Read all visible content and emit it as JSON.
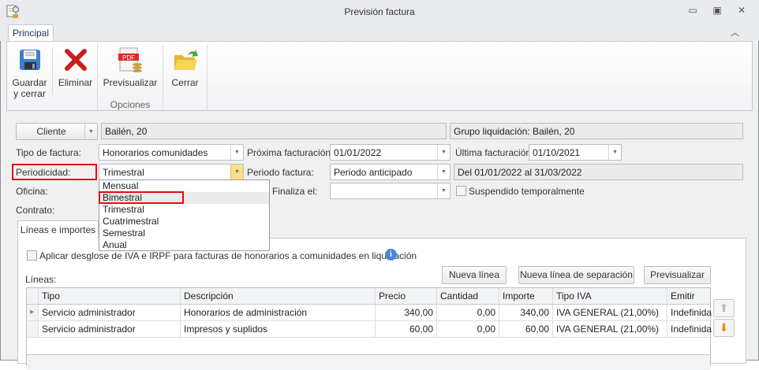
{
  "window": {
    "title": "Previsión factura",
    "minimize": "minimize",
    "maximize": "maximize",
    "close": "close"
  },
  "ribbon": {
    "tab": "Principal",
    "buttons": {
      "save_line1": "Guardar",
      "save_line2": "y cerrar",
      "delete": "Eliminar",
      "preview": "Previsualizar",
      "close": "Cerrar"
    },
    "group_label": "Opciones",
    "pdf_badge": "PDF"
  },
  "form": {
    "cliente_button": "Cliente",
    "cliente_value": "Bailén, 20",
    "grupo": "Grupo liquidación: Bailén, 20",
    "tipo_factura_label": "Tipo de factura:",
    "tipo_factura_value": "Honorarios comunidades",
    "proxima_label": "Próxima facturación:",
    "proxima_value": "01/01/2022",
    "ultima_label": "Última facturación:",
    "ultima_value": "01/10/2021",
    "periodicidad_label": "Periodicidad:",
    "periodicidad_value": "Trimestral",
    "periodo_label": "Periodo factura:",
    "periodo_value": "Periodo anticipado",
    "rango": "Del 01/01/2022 al 31/03/2022",
    "oficina_label": "Oficina:",
    "finaliza_label": "Finaliza el:",
    "finaliza_value": "",
    "suspendido_label": "Suspendido temporalmente",
    "contrato_label": "Contrato:"
  },
  "periodicidad_options": [
    "Mensual",
    "Bimestral",
    "Trimestral",
    "Cuatrimestral",
    "Semestral",
    "Anual"
  ],
  "lineas_tab": "Líneas e importes",
  "desglose_label": "Aplicar desglose de IVA e IRPF para facturas de honorarios a comunidades en liquidación",
  "lineas_label": "Líneas:",
  "buttons": {
    "nueva_linea": "Nueva línea",
    "nueva_separacion": "Nueva línea de separación",
    "previsualizar": "Previsualizar"
  },
  "grid": {
    "headers": [
      "Tipo",
      "Descripción",
      "Precio",
      "Cantidad",
      "Importe",
      "Tipo IVA",
      "Emitir"
    ],
    "rows": [
      [
        "Servicio administrador",
        "Honorarios de administración",
        "340,00",
        "0,00",
        "340,00",
        "IVA GENERAL (21,00%)",
        "Indefinida"
      ],
      [
        "Servicio administrador",
        "Impresos y suplidos",
        "60,00",
        "0,00",
        "60,00",
        "IVA GENERAL (21,00%)",
        "Indefinida"
      ]
    ]
  }
}
